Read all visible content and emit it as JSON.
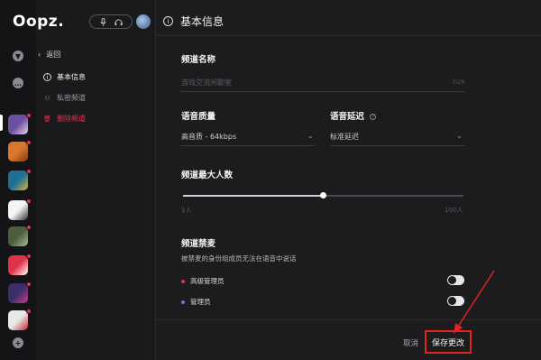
{
  "window": {
    "minimize": "—",
    "maximize": "□",
    "close": "✕"
  },
  "app": {
    "logo": "Oopz."
  },
  "rail": {
    "servers": [
      {
        "colors": [
          "#6b4fa0",
          "#e6d2e8"
        ]
      },
      {
        "colors": [
          "#d9772a",
          "#7a3a14"
        ]
      },
      {
        "colors": [
          "#1d6f93",
          "#d8b24a"
        ]
      },
      {
        "colors": [
          "#f4f4f4",
          "#333333"
        ]
      },
      {
        "colors": [
          "#4c5f3d",
          "#a9b99a"
        ]
      },
      {
        "colors": [
          "#e1324c",
          "#ffffff"
        ]
      },
      {
        "colors": [
          "#3a2f6a",
          "#c83c88"
        ]
      },
      {
        "colors": [
          "#e9e9ea",
          "#c0272d"
        ]
      }
    ]
  },
  "nav": {
    "back": "返回",
    "items": [
      {
        "label": "基本信息",
        "color": "#f0f0f0"
      },
      {
        "label": "私密频道",
        "color": "#9a9a9e"
      },
      {
        "label": "删除频道",
        "color": "#e0324e"
      }
    ]
  },
  "page": {
    "title": "基本信息",
    "channel_name": {
      "label": "频道名称",
      "placeholder": "游戏交流闲聊室",
      "counter": "7/20"
    },
    "voice_quality": {
      "label": "语音质量",
      "value": "高音质 - 64kbps"
    },
    "voice_delay": {
      "label": "语音延迟",
      "value": "标准延迟"
    },
    "max_users": {
      "label": "频道最大人数",
      "min_label": "1人",
      "max_label": "100人",
      "value_fraction": 0.5
    },
    "ban": {
      "label": "频道禁麦",
      "description": "被禁麦的身份组成员无法在语音中说话",
      "roles": [
        {
          "name": "高级管理员",
          "color": "#e0324e"
        },
        {
          "name": "管理员",
          "color": "#7a6cd8"
        }
      ]
    },
    "cancel": "取消",
    "save": "保存更改"
  }
}
